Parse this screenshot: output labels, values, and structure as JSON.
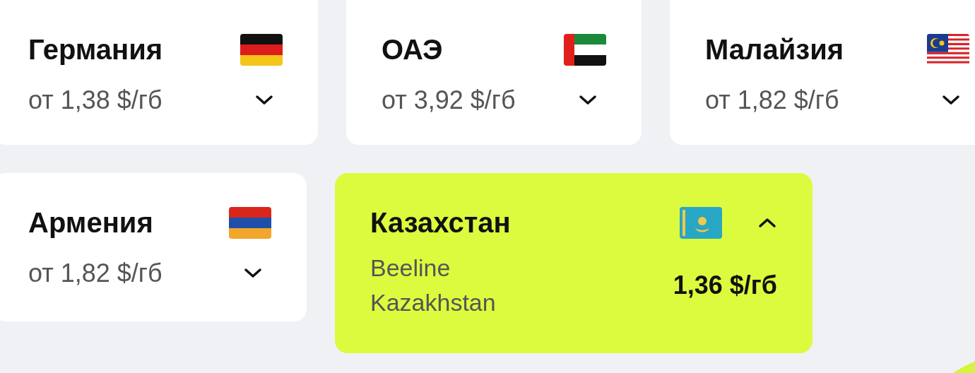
{
  "rows": [
    [
      {
        "name": "Германия",
        "price": "от 1,38 $/гб",
        "flag": {
          "kind": "de"
        },
        "expanded": false
      },
      {
        "name": "ОАЭ",
        "price": "от 3,92 $/гб",
        "flag": {
          "kind": "ae"
        },
        "expanded": false
      },
      {
        "name": "Малайзия",
        "price": "от 1,82 $/гб",
        "flag": {
          "kind": "my"
        },
        "expanded": false
      }
    ],
    [
      {
        "name": "Армения",
        "price": "от 1,82 $/гб",
        "flag": {
          "kind": "am"
        },
        "expanded": false
      },
      {
        "name": "Казахстан",
        "flag": {
          "kind": "kz"
        },
        "expanded": true,
        "operators": [
          {
            "name": "Beeline Kazakhstan",
            "price": "1,36 $/гб"
          }
        ]
      }
    ]
  ]
}
